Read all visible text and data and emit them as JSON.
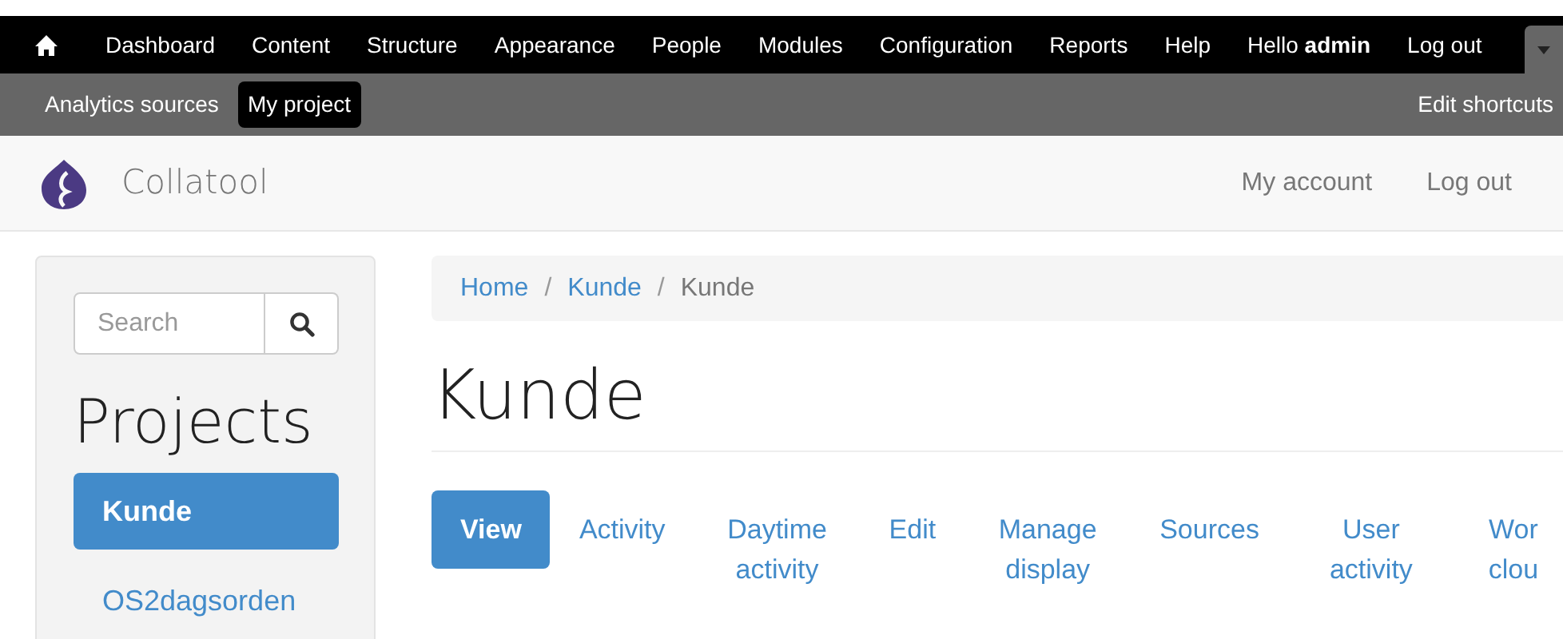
{
  "toolbar": {
    "items": [
      {
        "kind": "home"
      },
      {
        "kind": "link",
        "label": "Dashboard"
      },
      {
        "kind": "link",
        "label": "Content"
      },
      {
        "kind": "link",
        "label": "Structure"
      },
      {
        "kind": "link",
        "label": "Appearance"
      },
      {
        "kind": "link",
        "label": "People"
      },
      {
        "kind": "link",
        "label": "Modules"
      },
      {
        "kind": "link",
        "label": "Configuration"
      },
      {
        "kind": "link",
        "label": "Reports"
      },
      {
        "kind": "link",
        "label": "Help"
      },
      {
        "kind": "greeting",
        "label": "Hello **admin**"
      },
      {
        "kind": "link",
        "label": "Log out"
      }
    ]
  },
  "shortcuts": {
    "items": [
      {
        "label": "Analytics sources",
        "selected": false
      },
      {
        "label": "My project",
        "selected": true
      }
    ],
    "edit": "Edit shortcuts"
  },
  "header": {
    "brand": "Collatool",
    "links": [
      "My account",
      "Log out"
    ]
  },
  "sidebar": {
    "search": {
      "placeholder": "Search"
    },
    "heading": "Projects",
    "items": [
      {
        "label": "Kunde",
        "selected": true
      },
      {
        "label": "OS2dagsorden",
        "selected": false
      }
    ]
  },
  "breadcrumb": [
    {
      "label": "Home",
      "link": true
    },
    {
      "label": "/",
      "kind": "separator"
    },
    {
      "label": "Kunde",
      "link": true
    },
    {
      "label": "/",
      "kind": "separator"
    },
    {
      "label": "Kunde",
      "link": false
    }
  ],
  "title": "Kunde",
  "tabs": [
    {
      "label": "View",
      "selected": true
    },
    {
      "label": "Activity",
      "selected": false
    },
    {
      "label": "Daytime activity",
      "selected": false
    },
    {
      "label": "Edit",
      "selected": false
    },
    {
      "label": "Manage display",
      "selected": false
    },
    {
      "label": "Sources",
      "selected": false
    },
    {
      "label": "User activity",
      "selected": false
    },
    {
      "label": "Wor clou",
      "selected": false
    }
  ]
}
